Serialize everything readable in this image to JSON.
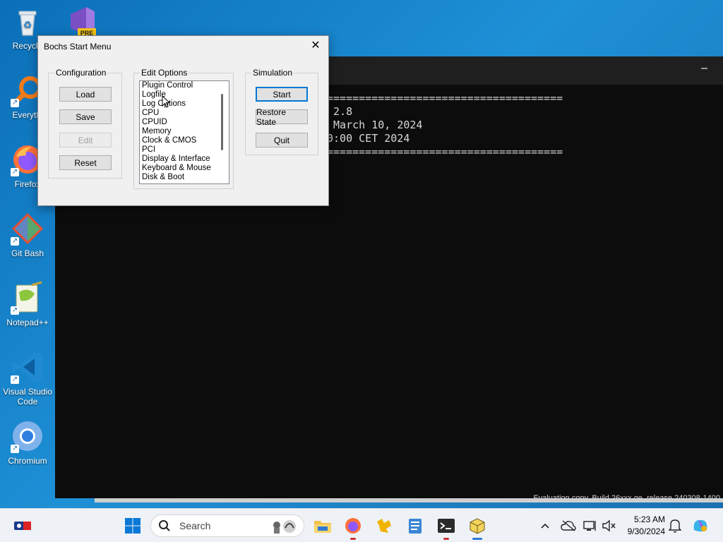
{
  "desktop": {
    "icons": [
      {
        "label": "Recycle",
        "icon": "recycle-bin-icon"
      },
      {
        "label": "Everythi",
        "icon": "everything-search-icon"
      },
      {
        "label": "Firefox",
        "icon": "firefox-icon"
      },
      {
        "label": "Git Bash",
        "icon": "git-bash-icon"
      },
      {
        "label": "Notepad++",
        "icon": "notepadpp-icon"
      },
      {
        "label": "Visual Studio Code",
        "icon": "vscode-icon"
      },
      {
        "label": "Chromium",
        "icon": "chromium-icon"
      }
    ],
    "top_icon_badge": "PRE"
  },
  "terminal": {
    "lines": [
      "=====================================",
      " 2.8",
      " March 10, 2024",
      "0:00 CET 2024",
      "====================================="
    ],
    "minimize": "–",
    "status": "Evaluation copy. Build 26xxx.ge_release.240308-1400"
  },
  "dialog": {
    "title": "Bochs Start Menu",
    "close": "✕",
    "configuration": {
      "legend": "Configuration",
      "load": "Load",
      "save": "Save",
      "edit": "Edit",
      "reset": "Reset"
    },
    "edit_options": {
      "legend": "Edit Options",
      "items": [
        "Plugin Control",
        "Logfile",
        "Log Options",
        "CPU",
        "CPUID",
        "Memory",
        "Clock & CMOS",
        "PCI",
        "Display & Interface",
        "Keyboard & Mouse",
        "Disk & Boot"
      ]
    },
    "simulation": {
      "legend": "Simulation",
      "start": "Start",
      "restore": "Restore State",
      "quit": "Quit"
    }
  },
  "taskbar": {
    "search_placeholder": "Search",
    "time": "5:23 AM",
    "date": "9/30/2024"
  }
}
